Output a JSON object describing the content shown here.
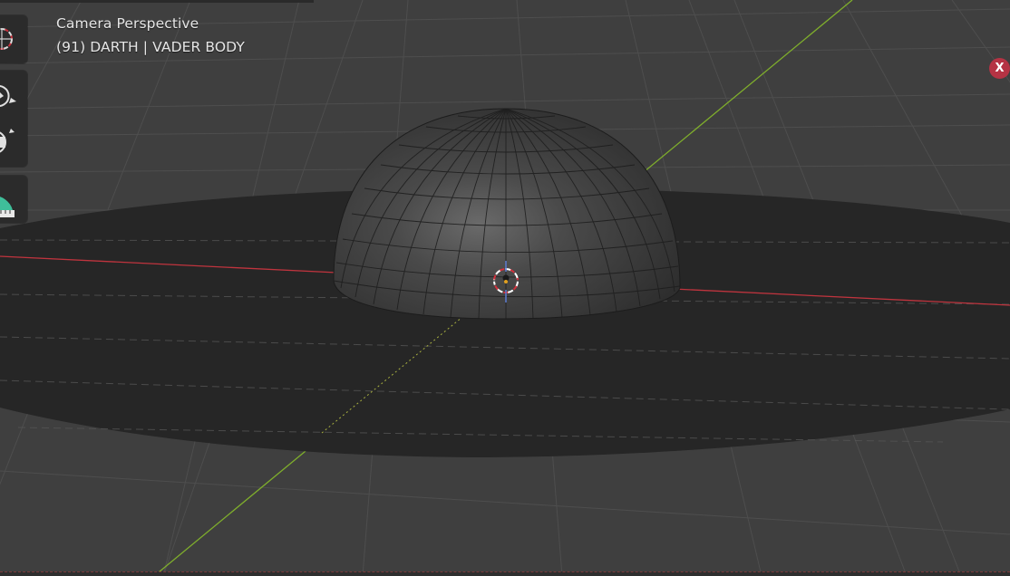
{
  "viewport": {
    "view_name": "Camera Perspective",
    "object_info": "(91) DARTH | VADER BODY",
    "close_label": "X"
  },
  "colors": {
    "background": "#3f3f3f",
    "grid_line": "#4f4f4f",
    "x_axis": "#c0343e",
    "y_axis": "#7fae2c",
    "ground_disc": "#282828",
    "dome": "#3a3a3a",
    "close_badge": "#b53344"
  },
  "toolbar": {
    "groups": [
      {
        "tools": [
          "cursor-tool-icon"
        ]
      },
      {
        "tools": [
          "rotate-icon",
          "transform-icon"
        ]
      },
      {
        "tools": [
          "measure-icon"
        ]
      }
    ]
  }
}
